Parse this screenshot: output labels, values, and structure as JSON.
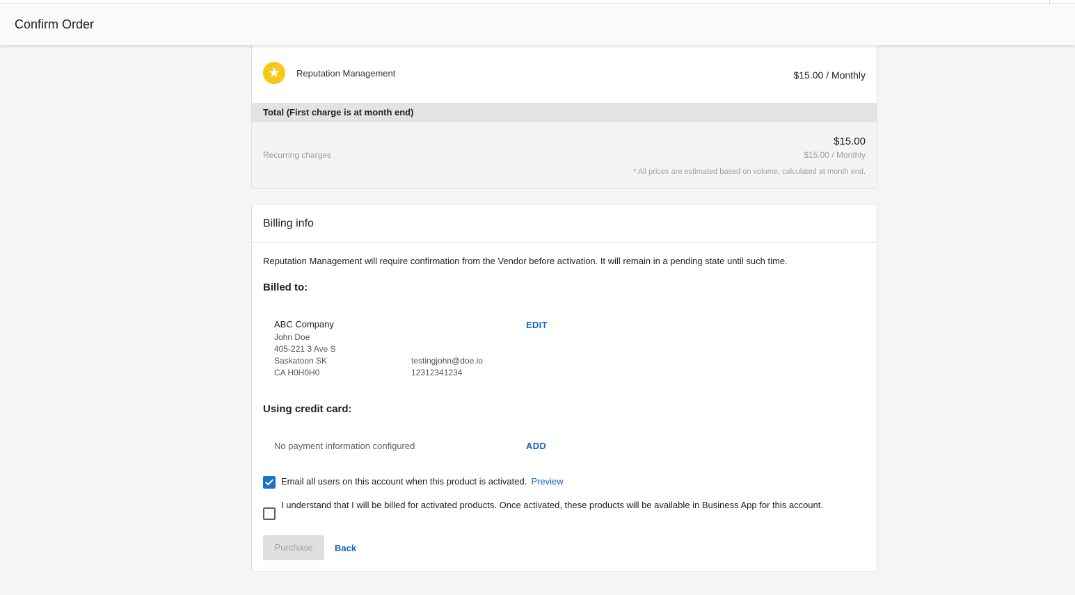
{
  "header": {
    "title": "Confirm Order"
  },
  "order": {
    "product": {
      "icon": "star-icon",
      "name": "Reputation Management",
      "price": "$15.00 / Monthly",
      "icon_color": "#f7c815"
    },
    "total_label": "Total (First charge is at month end)",
    "recurring_label": "Recurring charges",
    "recurring_total": "$15.00",
    "recurring_monthly": "$15.00 / Monthly",
    "note": "* All prices are estimated based on volume, calculated at month end."
  },
  "billing": {
    "title": "Billing info",
    "notice": "Reputation Management will require confirmation from the Vendor before activation. It will remain in a pending state until such time.",
    "billed_to_heading": "Billed to:",
    "company": "ABC Company",
    "contact": "John Doe",
    "address_line1": "405-221 3 Ave S",
    "city": "Saskatoon SK",
    "postal": "CA H0H0H0",
    "email": "testingjohn@doe.io",
    "phone": "12312341234",
    "edit_label": "EDIT",
    "credit_card_heading": "Using credit card:",
    "no_payment": "No payment information configured",
    "add_label": "ADD",
    "email_users_text": "Email all users on this account when this product is activated.",
    "email_users_checked": true,
    "preview_label": "Preview",
    "understand_text": "I understand that I will be billed for activated products. Once activated, these products will be available in Business App for this account.",
    "understand_checked": false,
    "purchase_label": "Purchase",
    "back_label": "Back"
  },
  "colors": {
    "link": "#1565c0",
    "checkbox_checked": "#1a73c8",
    "disabled_button": "#e0e0e0"
  }
}
